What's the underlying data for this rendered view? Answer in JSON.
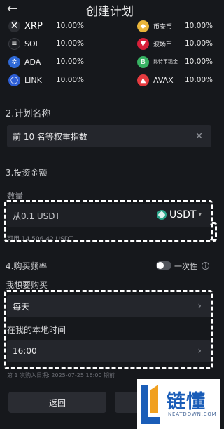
{
  "header": {
    "back_icon": "←",
    "title": "创建计划"
  },
  "coins_left": [
    {
      "name": "XRP",
      "pct": "10.00%",
      "color": "#2c2e33",
      "glyph": "✕"
    },
    {
      "name": "SOL",
      "pct": "10.00%",
      "color": "#1d1f24",
      "glyph": "≡"
    },
    {
      "name": "ADA",
      "pct": "10.00%",
      "color": "#2f6ad8",
      "glyph": "✲"
    },
    {
      "name": "LINK",
      "pct": "10.00%",
      "color": "#2e5fd6",
      "glyph": "◯"
    }
  ],
  "coins_right": [
    {
      "name": "币安币",
      "pct": "10.00%",
      "color": "#e9b53a",
      "glyph": "◆"
    },
    {
      "name": "波场币",
      "pct": "10.00%",
      "color": "#d8203a",
      "glyph": "▼"
    },
    {
      "name": "比特币现金",
      "pct": "10.00%",
      "color": "#38b363",
      "glyph": "B"
    },
    {
      "name": "AVAX",
      "pct": "10.00%",
      "color": "#e53a3f",
      "glyph": "▲"
    }
  ],
  "plan_name": {
    "label": "2.计划名称",
    "value": "前 10 名等权重指数",
    "clear_icon": "✕"
  },
  "invest": {
    "label": "3.投资金额",
    "qty_label": "数量",
    "placeholder": "从0.1 USDT",
    "currency": "USDT",
    "available": "可用 14,506.42 USDT"
  },
  "frequency": {
    "label": "4.购买频率",
    "toggle_label": "一次性",
    "want_label": "我想要购买",
    "value": "每天",
    "time_label": "在我的本地时间",
    "time_value": "16:00",
    "first_buy_note": "第 1 次购入日期: 2025-07-25 16:00 期前"
  },
  "buttons": {
    "back": "返回",
    "next": ""
  },
  "watermark": {
    "brand": "链懂",
    "domain": "NEATDOWN.COM"
  }
}
